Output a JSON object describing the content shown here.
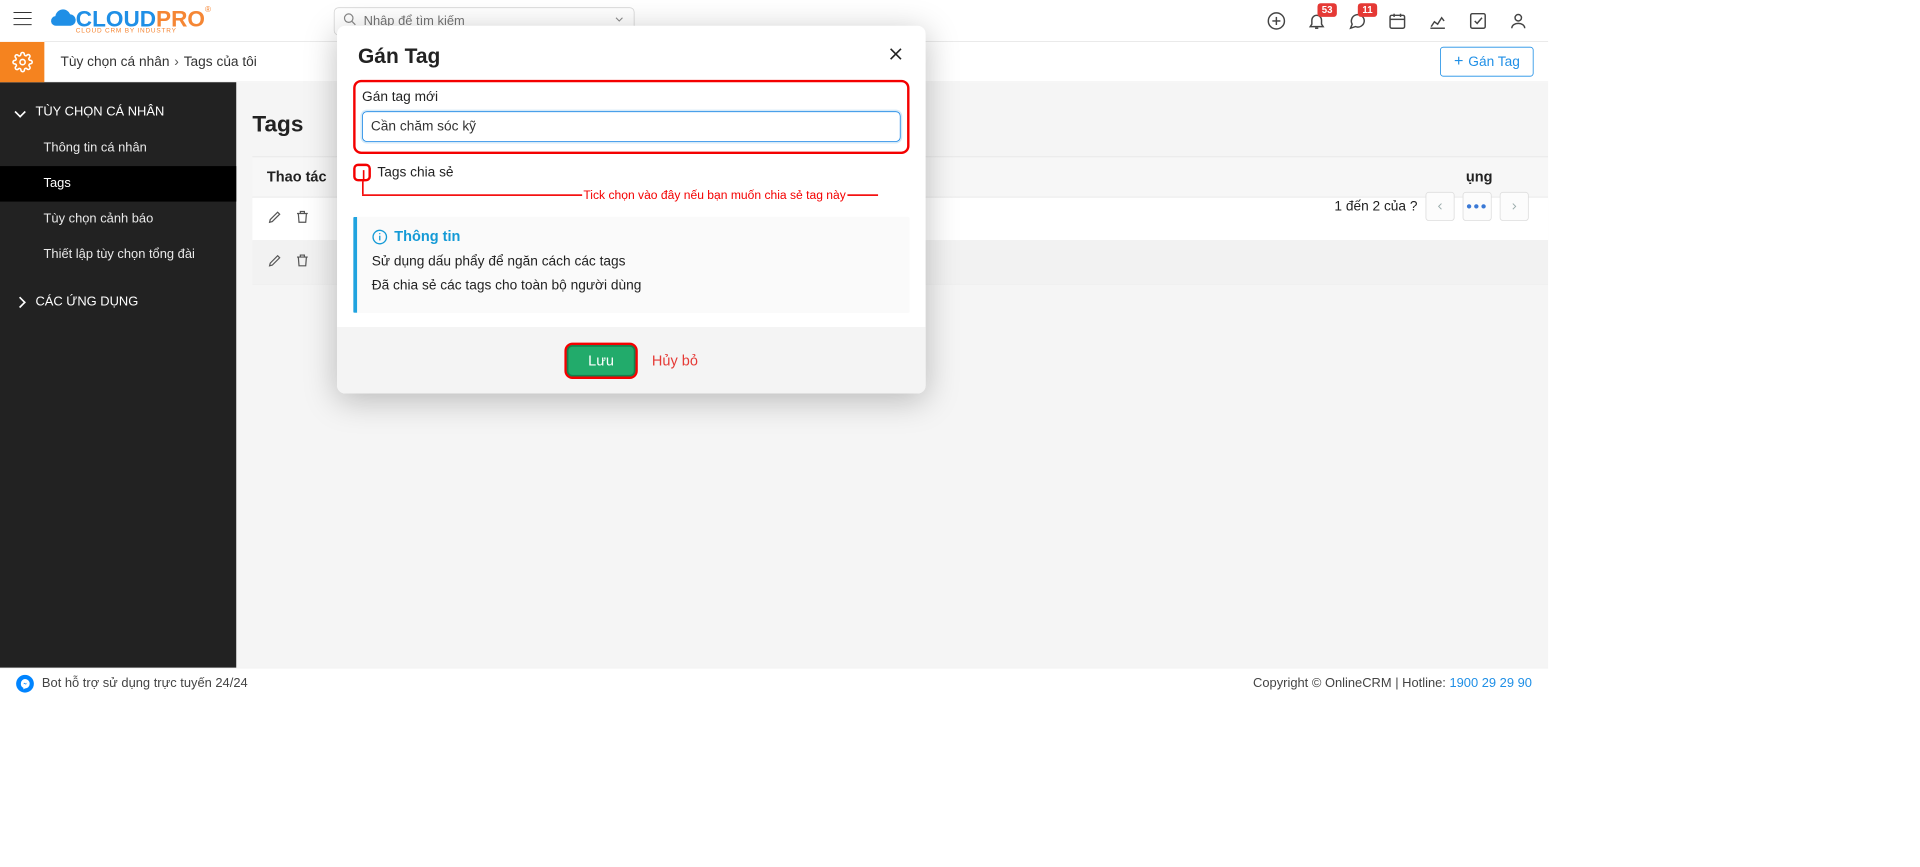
{
  "header": {
    "search_placeholder": "Nhập để tìm kiếm",
    "notif_count": "53",
    "msg_count": "11"
  },
  "breadcrumb": {
    "root": "Tùy chọn cá nhân",
    "leaf": "Tags của tôi"
  },
  "buttons": {
    "gantag": "Gán Tag"
  },
  "sidebar": {
    "group1": "TÙY CHỌN CÁ NHÂN",
    "items": {
      "info": "Thông tin cá nhân",
      "tags": "Tags",
      "warn": "Tùy chọn cảnh báo",
      "pbx": "Thiết lập tùy chọn tổng đài"
    },
    "group2": "CÁC ỨNG DỤNG"
  },
  "content": {
    "title": "Tags",
    "col_actions": "Thao tác",
    "col_usage_partial": "ụng",
    "paging_text": "1 đến 2 của  ?"
  },
  "modal": {
    "title": "Gán Tag",
    "field_label": "Gán tag mới",
    "input_value": "Cần chăm sóc kỹ",
    "share_label": "Tags chia sẻ",
    "annotation": "Tick chọn vào đây nếu bạn muốn chia sẻ tag này",
    "info_title": "Thông tin",
    "info_line1": "Sử dụng dấu phẩy để ngăn cách các tags",
    "info_line2": "Đã chia sẻ các tags cho toàn bộ người dùng",
    "save": "Lưu",
    "cancel": "Hủy bỏ"
  },
  "footer": {
    "bot_text": "Bot hỗ trợ sử dụng trực tuyến 24/24",
    "copyright": "Copyright © OnlineCRM | Hotline: ",
    "hotline": "1900 29 29 90"
  }
}
